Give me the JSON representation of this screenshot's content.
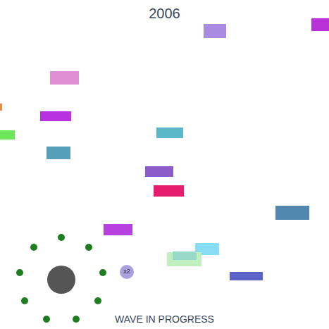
{
  "score": "2006",
  "status": "WAVE IN PROGRESS",
  "bricks": [
    {
      "color": "#a98ce0"
    },
    {
      "color": "#b832d8"
    },
    {
      "color": "#e08fd4"
    },
    {
      "color": "#e09050"
    },
    {
      "color": "#b832e0"
    },
    {
      "color": "#6de65a"
    },
    {
      "color": "#5bb8c8"
    },
    {
      "color": "#55a0b8"
    },
    {
      "color": "#8c5cc8"
    },
    {
      "color": "#e81c6c"
    },
    {
      "color": "#5088b0"
    },
    {
      "color": "#b840e0"
    },
    {
      "color": "#88ddf5"
    },
    {
      "color": "#c0f0c0"
    },
    {
      "color": "#98d8c8"
    },
    {
      "color": "#5c64c8"
    }
  ],
  "player": {
    "orbs": 9
  },
  "powerup": {
    "label": "x2"
  }
}
